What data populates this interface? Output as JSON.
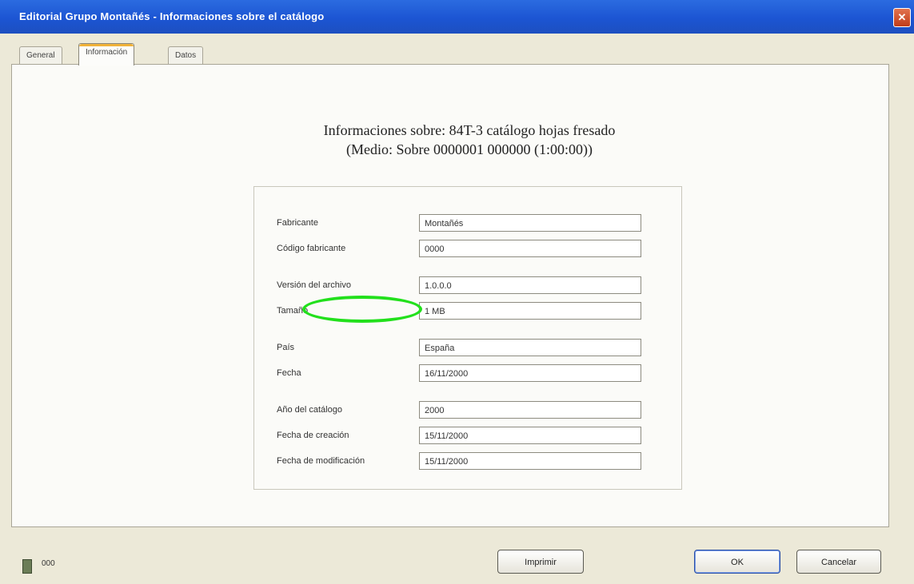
{
  "window": {
    "title": "Editorial Grupo Montañés - Informaciones sobre el catálogo",
    "close_glyph": "✕"
  },
  "tabs": [
    {
      "label": "General"
    },
    {
      "label": "Información"
    },
    {
      "label": "Datos"
    }
  ],
  "main": {
    "heading_line1": "Informaciones sobre: 84T-3 catálogo hojas fresado",
    "heading_line2": "(Medio: Sobre 0000001 000000 (1:00:00))"
  },
  "fields": [
    {
      "label": "Fabricante",
      "value": "Montañés"
    },
    {
      "label": "Código fabricante",
      "value": "0000"
    },
    {
      "label": "Versión del archivo",
      "value": "1.0.0.0"
    },
    {
      "label": "Tamaño",
      "value": "1 MB"
    },
    {
      "label": "País",
      "value": "España"
    },
    {
      "label": "Fecha",
      "value": "16/11/2000"
    },
    {
      "label": "Año del catálogo",
      "value": "2000"
    },
    {
      "label": "Fecha de creación",
      "value": "15/11/2000"
    },
    {
      "label": "Fecha de modificación",
      "value": "15/11/2000"
    }
  ],
  "status": {
    "icon": "document-icon",
    "text": "000"
  },
  "buttons": {
    "center_label": "Imprimir",
    "ok_label": "OK",
    "cancel_label": "Cancelar"
  },
  "colors": {
    "titlebar": "#1c55d3",
    "highlight": "#22e01c",
    "active_tab_accent": "#f0b23a"
  }
}
